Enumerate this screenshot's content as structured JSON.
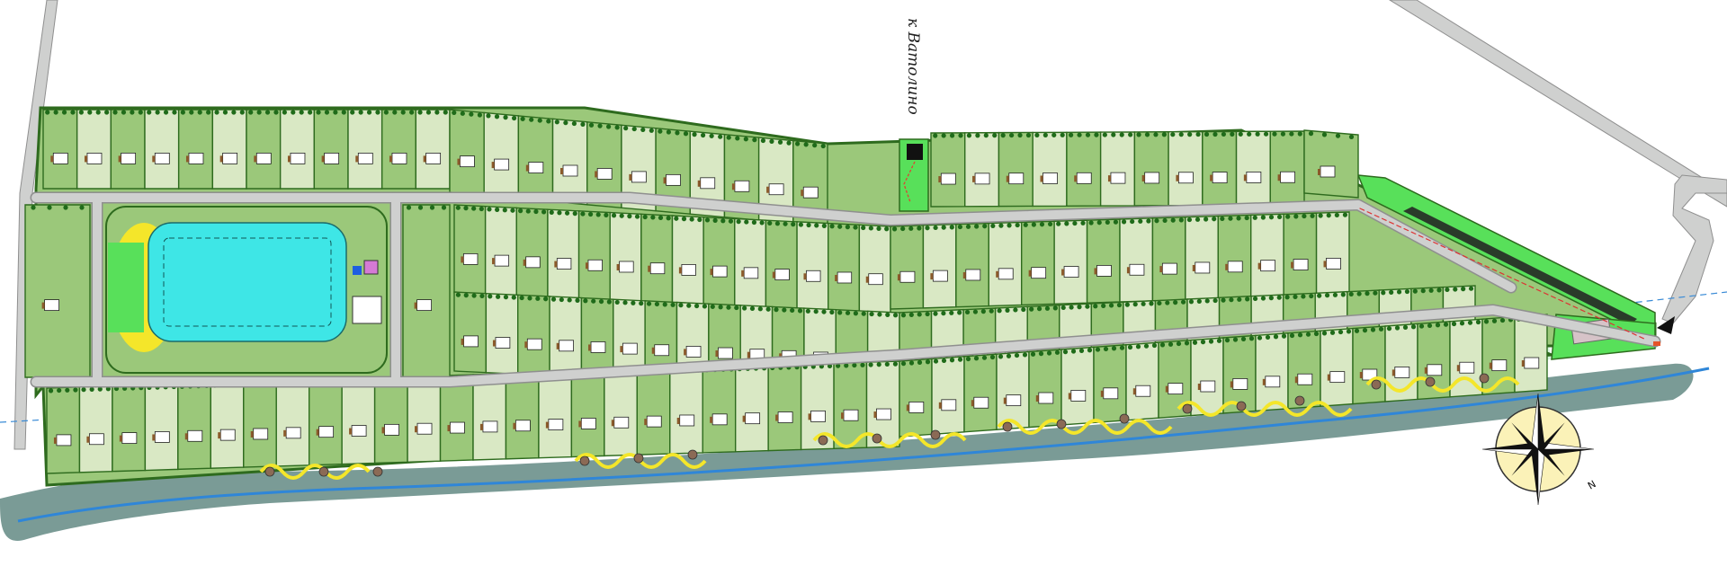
{
  "map": {
    "road_label": "к Ватолино",
    "compass_letter": "N",
    "colors": {
      "background": "#ffffff",
      "road": "#cfd0cf",
      "road_edge": "#9a9a9a",
      "plot_light": "#d9e8c4",
      "plot_dark": "#9bc87a",
      "plot_border": "#2e6b1e",
      "tree": "#1f6b1a",
      "pool_water": "#3ee6e6",
      "bright_green": "#58e05a",
      "river": "#7a9b96",
      "river_edge": "#2f86d8",
      "path_yellow": "#f4e62a"
    }
  }
}
